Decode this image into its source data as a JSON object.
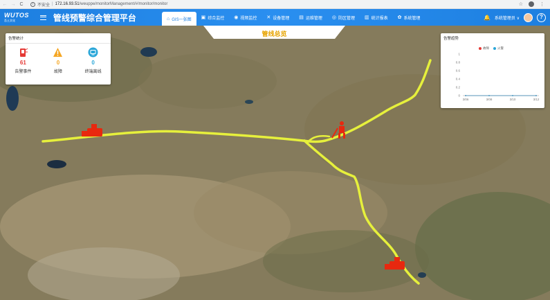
{
  "browser": {
    "security_label": "不安全",
    "url_host": "172.16.93.51",
    "url_path": "/weuppe/monitorManagement/#/monitor/monitor",
    "back_glyph": "←",
    "forward_glyph": "→",
    "reload_glyph": "C",
    "star_glyph": "☆",
    "more_glyph": "⋮"
  },
  "header": {
    "logo_text": "WUTOS",
    "logo_sub": "吾土文化",
    "title": "管线预警综合管理平台",
    "nav": [
      {
        "label": "GIS一张图",
        "icon": "home-icon",
        "glyph": "⌂",
        "active": true
      },
      {
        "label": "综合监控",
        "icon": "monitor-icon",
        "glyph": "▣",
        "active": false
      },
      {
        "label": "视频监控",
        "icon": "video-icon",
        "glyph": "◉",
        "active": false
      },
      {
        "label": "设备管理",
        "icon": "tools-icon",
        "glyph": "✕",
        "active": false
      },
      {
        "label": "运维管理",
        "icon": "maintenance-icon",
        "glyph": "▤",
        "active": false
      },
      {
        "label": "防区管理",
        "icon": "zone-icon",
        "glyph": "◎",
        "active": false
      },
      {
        "label": "统计报表",
        "icon": "chart-icon",
        "glyph": "▥",
        "active": false
      },
      {
        "label": "系统管理",
        "icon": "settings-icon",
        "glyph": "✿",
        "active": false
      }
    ],
    "user_name": "系统管理员",
    "bell_glyph": "🔔",
    "chevron_glyph": "∨",
    "help_glyph": "?"
  },
  "tab_banner": {
    "label": "管线总览"
  },
  "alarm_stats": {
    "title": "告警统计",
    "items": [
      {
        "label": "告警事件",
        "value": "61",
        "color": "#e53935",
        "icon": "alarm-device-icon"
      },
      {
        "label": "故障",
        "value": "0",
        "color": "#f5a623",
        "icon": "warning-icon"
      },
      {
        "label": "终端离线",
        "value": "0",
        "color": "#2aa6d8",
        "icon": "offline-terminal-icon"
      }
    ]
  },
  "trend": {
    "title": "告警趋势",
    "chart_data": {
      "type": "line",
      "x": [
        "3/06",
        "3/08",
        "3/10",
        "3/12"
      ],
      "series": [
        {
          "name": "故障",
          "values": [
            0,
            0,
            0,
            0
          ],
          "color": "#e53935"
        },
        {
          "name": "火警",
          "values": [
            0,
            0,
            0,
            0
          ],
          "color": "#2aa6d8"
        }
      ],
      "ylim": [
        0,
        1
      ],
      "yticks": [
        "1",
        "0.8",
        "0.6",
        "0.4",
        "0.2",
        "0"
      ],
      "grid": false,
      "legend": "top-center"
    }
  },
  "colors": {
    "header": "#1d7fe0",
    "pipeline": "#e6f03c",
    "marker": "#e8280f",
    "accent_orange": "#e7a400"
  }
}
